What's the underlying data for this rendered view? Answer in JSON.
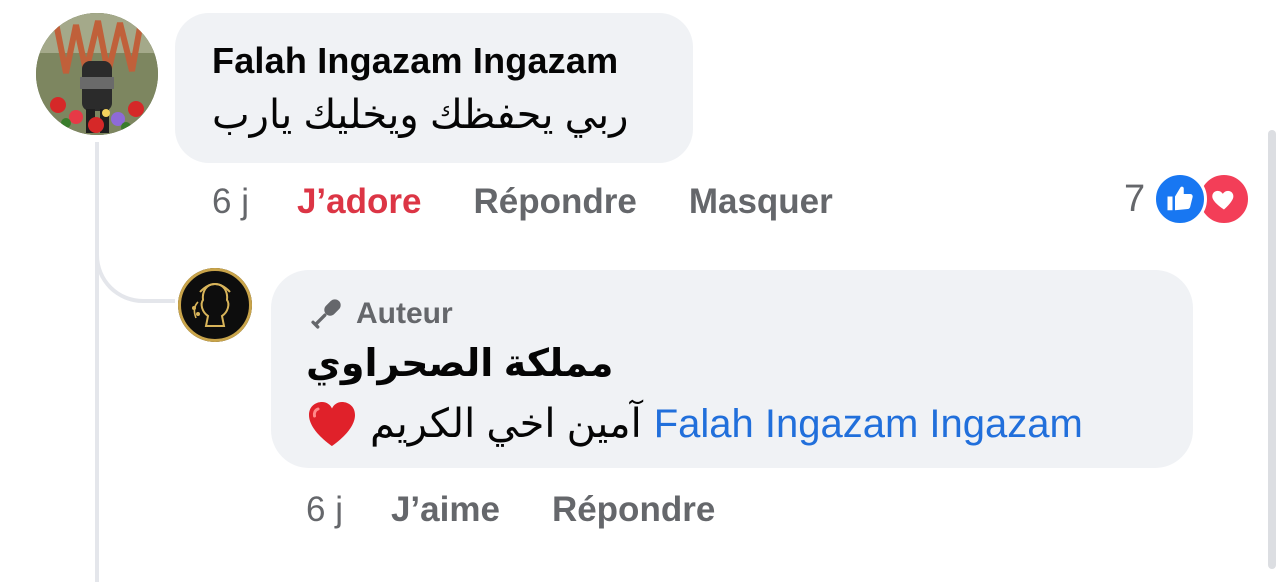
{
  "comment": {
    "author": "Falah Ingazam Ingazam",
    "text": "ربي يحفظك ويخليك يارب",
    "time": "6 j",
    "actions": {
      "love_label": "J’adore",
      "reply_label": "Répondre",
      "hide_label": "Masquer"
    },
    "reactions": {
      "count": "7",
      "icons": [
        "like-icon",
        "love-icon"
      ]
    }
  },
  "reply": {
    "badge_label": "Auteur",
    "author": "مملكة الصحراوي",
    "mention": "Falah Ingazam Ingazam",
    "text": "آمين اخي الكريم",
    "emoji": "red-heart-emoji",
    "time": "6 j",
    "actions": {
      "like_label": "J’aime",
      "reply_label": "Répondre"
    }
  },
  "colors": {
    "bubble": "#f0f2f5",
    "secondary_text": "#65676b",
    "love_red": "#dc3545",
    "mention_blue": "#216fdb",
    "like_blue": "#1877f2",
    "love_pink": "#f33e58"
  }
}
